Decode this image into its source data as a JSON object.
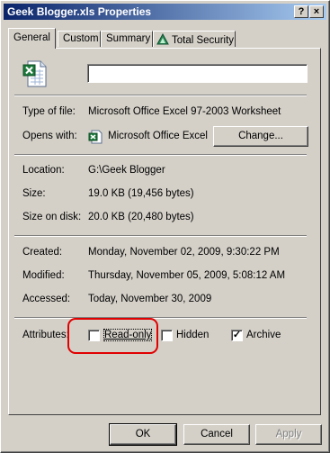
{
  "window": {
    "title": "Geek Blogger.xls Properties",
    "help_glyph": "?",
    "close_glyph": "×"
  },
  "tabs": [
    {
      "label": "General",
      "active": true
    },
    {
      "label": "Custom",
      "active": false
    },
    {
      "label": "Summary",
      "active": false
    },
    {
      "label": "Total Security",
      "active": false
    }
  ],
  "general": {
    "file_name": "",
    "type_label": "Type of file:",
    "type_value": "Microsoft Office Excel 97-2003 Worksheet",
    "opens_label": "Opens with:",
    "opens_value": "Microsoft Office Excel",
    "change_label": "Change...",
    "location_label": "Location:",
    "location_value": "G:\\Geek Blogger",
    "size_label": "Size:",
    "size_value": "19.0 KB (19,456 bytes)",
    "size_on_disk_label": "Size on disk:",
    "size_on_disk_value": "20.0 KB (20,480 bytes)",
    "created_label": "Created:",
    "created_value": "Monday, November 02, 2009, 9:30:22 PM",
    "modified_label": "Modified:",
    "modified_value": "Thursday, November 05, 2009, 5:08:12 AM",
    "accessed_label": "Accessed:",
    "accessed_value": "Today, November 30, 2009",
    "attributes_label": "Attributes:",
    "attributes": [
      {
        "label": "Read-only",
        "checked": false
      },
      {
        "label": "Hidden",
        "checked": false
      },
      {
        "label": "Archive",
        "checked": true
      }
    ]
  },
  "footer": {
    "ok_label": "OK",
    "cancel_label": "Cancel",
    "apply_label": "Apply"
  },
  "colors": {
    "highlight": "#e00000",
    "titlebar_start": "#0a246a",
    "titlebar_end": "#a6caf0"
  },
  "icons": {
    "file_icon": "excel-file-icon",
    "app_icon": "excel-app-icon",
    "tab_icon": "total-security-icon"
  }
}
